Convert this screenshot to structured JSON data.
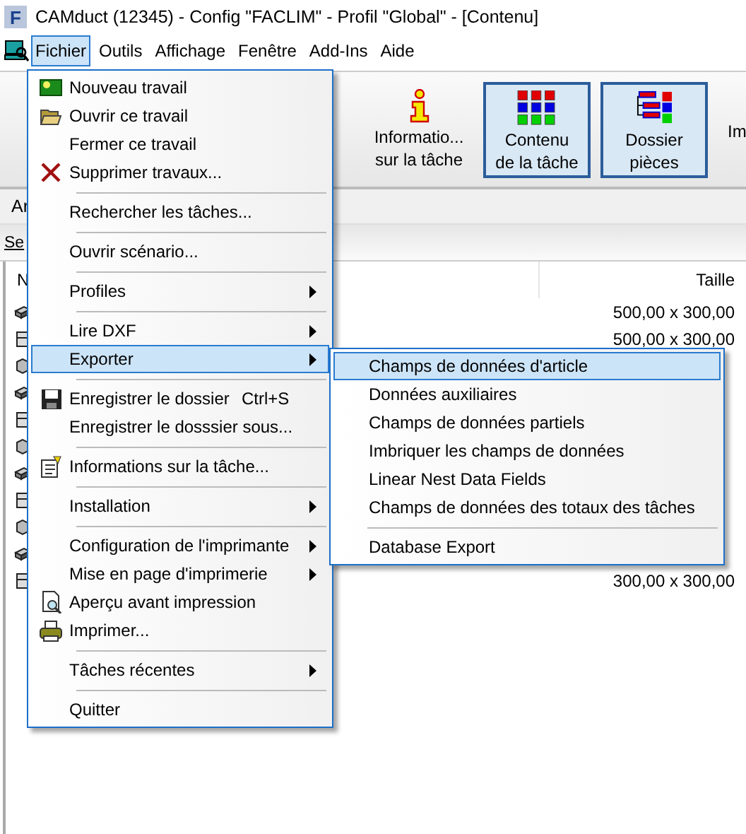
{
  "window": {
    "icon_text": "F",
    "title": "CAMduct (12345) - Config \"FACLIM\" - Profil \"Global\" - [Contenu]"
  },
  "menubar": [
    {
      "label": "Fichier",
      "selected": true
    },
    {
      "label": "Outils",
      "selected": false
    },
    {
      "label": "Affichage",
      "selected": false
    },
    {
      "label": "Fenêtre",
      "selected": false
    },
    {
      "label": "Add-Ins",
      "selected": false
    },
    {
      "label": "Aide",
      "selected": false
    }
  ],
  "toolbar": [
    {
      "label": "Informatio... sur la tâche",
      "selected": false
    },
    {
      "label": "Contenu de la tâche",
      "selected": true
    },
    {
      "label": "Dossier pièces",
      "selected": true
    },
    {
      "label": "Im",
      "selected": false
    }
  ],
  "tab_strip": {
    "tab": "Ar"
  },
  "filter_link": "Se",
  "table": {
    "columns": [
      "N",
      "Taille"
    ],
    "rows": [
      {
        "size": "500,00 x 300,00"
      },
      {
        "size": "500,00 x 300,00"
      },
      {},
      {},
      {},
      {},
      {},
      {},
      {},
      {},
      {
        "size": "300,00 x 300,00"
      }
    ]
  },
  "file_menu": [
    {
      "kind": "item",
      "label": "Nouveau travail",
      "selected": false
    },
    {
      "kind": "item",
      "label": "Ouvrir ce travail",
      "selected": false
    },
    {
      "kind": "item",
      "label": "Fermer ce travail",
      "selected": false
    },
    {
      "kind": "item",
      "label": "Supprimer travaux...",
      "selected": false
    },
    {
      "kind": "separator"
    },
    {
      "kind": "item",
      "label": "Rechercher les tâches...",
      "selected": false
    },
    {
      "kind": "separator"
    },
    {
      "kind": "item",
      "label": "Ouvrir scénario...",
      "selected": false
    },
    {
      "kind": "separator"
    },
    {
      "kind": "submenu",
      "label": "Profiles",
      "selected": false
    },
    {
      "kind": "separator"
    },
    {
      "kind": "submenu",
      "label": "Lire DXF",
      "selected": false
    },
    {
      "kind": "submenu",
      "label": "Exporter",
      "selected": true
    },
    {
      "kind": "separator"
    },
    {
      "kind": "item",
      "label": "Enregistrer le dossier",
      "shortcut": "Ctrl+S",
      "selected": false
    },
    {
      "kind": "item",
      "label": "Enregistrer le dosssier sous...",
      "selected": false
    },
    {
      "kind": "separator"
    },
    {
      "kind": "item",
      "label": "Informations sur la tâche...",
      "selected": false
    },
    {
      "kind": "separator"
    },
    {
      "kind": "submenu",
      "label": "Installation",
      "selected": false
    },
    {
      "kind": "separator"
    },
    {
      "kind": "submenu",
      "label": "Configuration de l'imprimante",
      "selected": false
    },
    {
      "kind": "submenu",
      "label": "Mise en page d'imprimerie",
      "selected": false
    },
    {
      "kind": "item",
      "label": "Aperçu avant impression",
      "selected": false
    },
    {
      "kind": "item",
      "label": "Imprimer...",
      "selected": false
    },
    {
      "kind": "separator"
    },
    {
      "kind": "submenu",
      "label": "Tâches récentes",
      "selected": false
    },
    {
      "kind": "separator"
    },
    {
      "kind": "item",
      "label": "Quitter",
      "selected": false
    }
  ],
  "export_submenu": [
    {
      "kind": "item",
      "label": "Champs de données d'article",
      "selected": true
    },
    {
      "kind": "item",
      "label": "Données auxiliaires",
      "selected": false
    },
    {
      "kind": "item",
      "label": "Champs de données partiels",
      "selected": false
    },
    {
      "kind": "item",
      "label": "Imbriquer les champs de données",
      "selected": false
    },
    {
      "kind": "item",
      "label": "Linear Nest Data Fields",
      "selected": false
    },
    {
      "kind": "item",
      "label": "Champs de données des totaux des tâches",
      "selected": false
    },
    {
      "kind": "separator"
    },
    {
      "kind": "item",
      "label": "Database Export",
      "selected": false
    }
  ]
}
